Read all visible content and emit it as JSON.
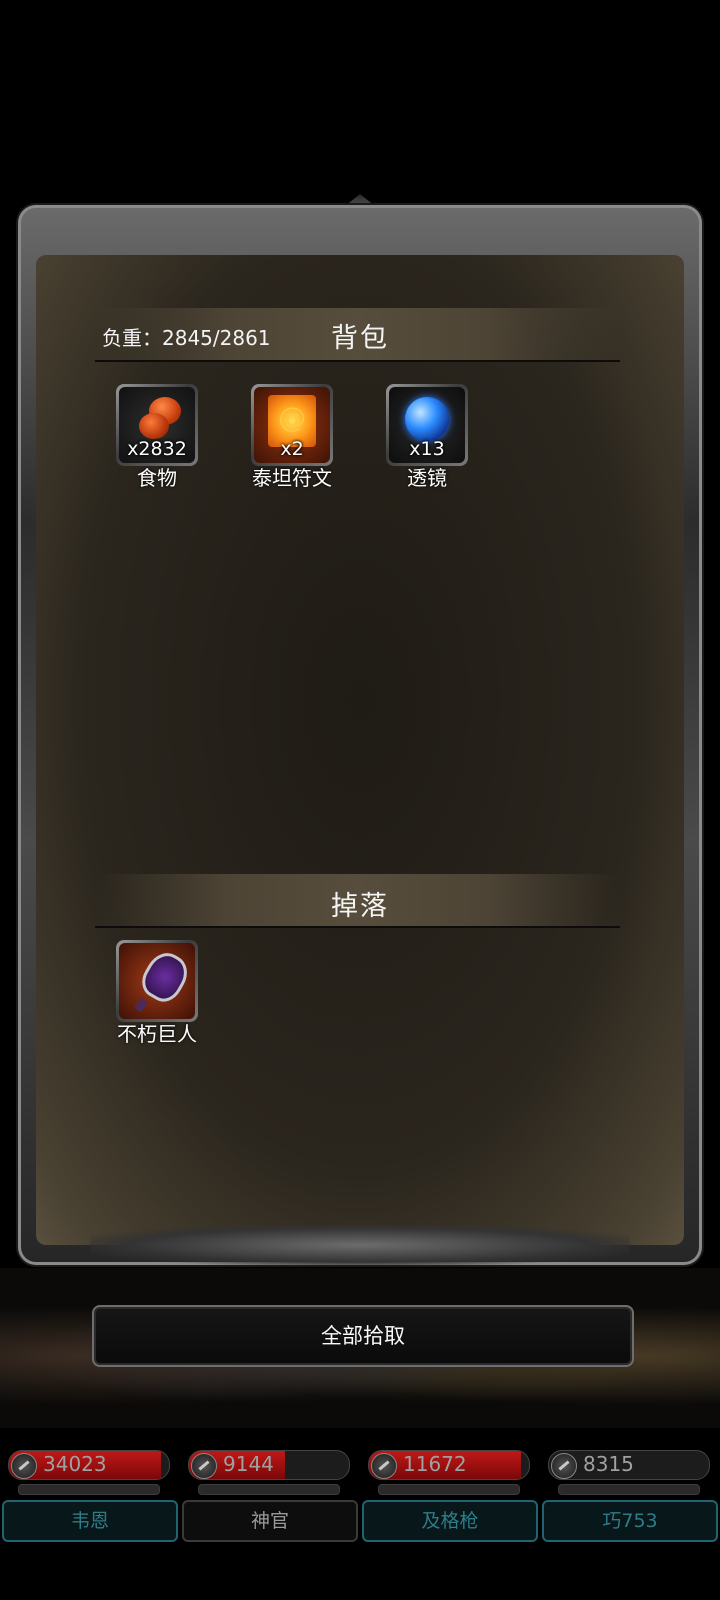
{
  "inventory": {
    "weight_label": "负重：2845/2861",
    "title": "背包",
    "items": [
      {
        "icon": "food-icon",
        "count": "x2832",
        "name": "食物"
      },
      {
        "icon": "rune-icon",
        "count": "x2",
        "name": "泰坦符文"
      },
      {
        "icon": "lens-icon",
        "count": "x13",
        "name": "透镜"
      }
    ]
  },
  "drops": {
    "title": "掉落",
    "items": [
      {
        "icon": "weapon-icon",
        "name": "不朽巨人"
      }
    ]
  },
  "actions": {
    "pickup_all": "全部拾取"
  },
  "heroes": [
    {
      "hp": "34023",
      "hp_fill": 0.95,
      "name": "韦恩",
      "name_active": true
    },
    {
      "hp": "9144",
      "hp_fill": 0.6,
      "name": "神官",
      "name_active": false
    },
    {
      "hp": "11672",
      "hp_fill": 0.95,
      "name": "及格枪",
      "name_active": true
    },
    {
      "hp": "8315",
      "hp_fill": 0.0,
      "name": "巧753",
      "name_active": true
    }
  ],
  "colors": {
    "hp_red": "#c01818",
    "name_teal": "#2e7c88",
    "panel_parchment": "#2a251d"
  }
}
